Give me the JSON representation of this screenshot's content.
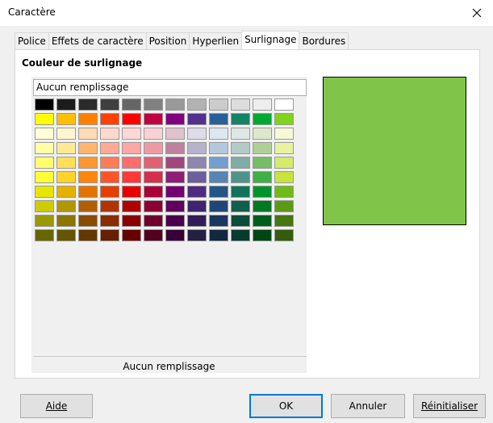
{
  "dialog": {
    "title": "Caractère"
  },
  "tabs": [
    {
      "label": "Police"
    },
    {
      "label": "Effets de caractère"
    },
    {
      "label": "Position"
    },
    {
      "label": "Hyperlien"
    },
    {
      "label": "Surlignage"
    },
    {
      "label": "Bordures"
    }
  ],
  "active_tab": 4,
  "section": {
    "title": "Couleur de surlignage"
  },
  "palette": {
    "no_fill_button": "Aucun remplissage",
    "selected_label": "Aucun remplissage",
    "rows": [
      [
        "#000000",
        "#1c1c1c",
        "#2b2b2b",
        "#3f3f3f",
        "#666666",
        "#808080",
        "#999999",
        "#b2b2b2",
        "#cccccc",
        "#dddddd",
        "#eeeeee",
        "#ffffff"
      ],
      [
        "#ffff00",
        "#ffbf00",
        "#ff8000",
        "#ff4000",
        "#ff0000",
        "#bf0041",
        "#800080",
        "#55308d",
        "#2a6099",
        "#158466",
        "#00a933",
        "#81d41a"
      ],
      [
        "#ffffd7",
        "#fff5ce",
        "#ffdbb6",
        "#ffd8ce",
        "#ffd7d7",
        "#f7d1d5",
        "#e0c2cd",
        "#dedce6",
        "#dee6ef",
        "#dee7e5",
        "#dde8cb",
        "#f6f9d4"
      ],
      [
        "#ffffa6",
        "#ffe994",
        "#ffb66c",
        "#ffaa95",
        "#ffa6a6",
        "#ec9ba4",
        "#bf819e",
        "#b7b3ca",
        "#b4c7dc",
        "#b3cac7",
        "#afd095",
        "#e8f2a1"
      ],
      [
        "#ffff6d",
        "#ffde59",
        "#ff972f",
        "#ff7b59",
        "#ff6d6d",
        "#e16173",
        "#a1467e",
        "#8e86ae",
        "#729fcf",
        "#81aca6",
        "#77bc65",
        "#d4ea6b"
      ],
      [
        "#ffff38",
        "#ffd428",
        "#ff860d",
        "#ff5429",
        "#ff3838",
        "#d62e4e",
        "#8d1d75",
        "#6b5e9b",
        "#5983b0",
        "#50938a",
        "#3faf46",
        "#c9e33c"
      ],
      [
        "#e6e600",
        "#e6b000",
        "#e67300",
        "#e63d00",
        "#e60000",
        "#a9003a",
        "#730073",
        "#4c2b80",
        "#255587",
        "#12735b",
        "#009428",
        "#70bb17"
      ],
      [
        "#cccc00",
        "#b29600",
        "#b15f00",
        "#b13400",
        "#b00000",
        "#8d0033",
        "#5f005f",
        "#3e2370",
        "#1f4677",
        "#0e5f4c",
        "#007824",
        "#5c9a13"
      ],
      [
        "#999900",
        "#8c7500",
        "#8a4c00",
        "#8a2b00",
        "#8b0000",
        "#70002b",
        "#4b004b",
        "#311c59",
        "#19375f",
        "#0b4c3c",
        "#005e1c",
        "#467610"
      ],
      [
        "#666600",
        "#665500",
        "#663800",
        "#662000",
        "#660000",
        "#520020",
        "#380038",
        "#242041",
        "#12283f",
        "#083a2e",
        "#004613",
        "#355c0c"
      ]
    ]
  },
  "preview": {
    "color": "#81c44a"
  },
  "buttons": {
    "help": "Aide",
    "ok": "OK",
    "cancel": "Annuler",
    "reset": "Réinitialiser"
  }
}
